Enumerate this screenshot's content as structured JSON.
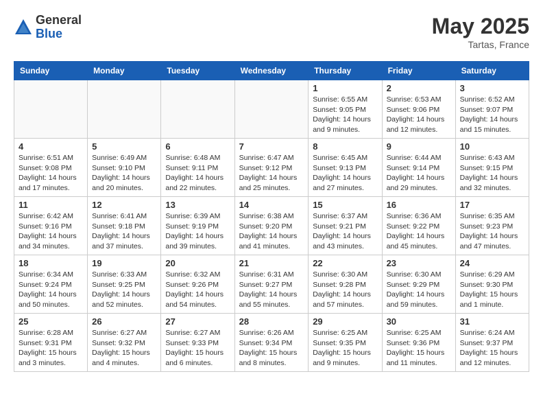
{
  "logo": {
    "general": "General",
    "blue": "Blue"
  },
  "title": "May 2025",
  "location": "Tartas, France",
  "days_header": [
    "Sunday",
    "Monday",
    "Tuesday",
    "Wednesday",
    "Thursday",
    "Friday",
    "Saturday"
  ],
  "weeks": [
    [
      {
        "day": "",
        "info": ""
      },
      {
        "day": "",
        "info": ""
      },
      {
        "day": "",
        "info": ""
      },
      {
        "day": "",
        "info": ""
      },
      {
        "day": "1",
        "info": "Sunrise: 6:55 AM\nSunset: 9:05 PM\nDaylight: 14 hours\nand 9 minutes."
      },
      {
        "day": "2",
        "info": "Sunrise: 6:53 AM\nSunset: 9:06 PM\nDaylight: 14 hours\nand 12 minutes."
      },
      {
        "day": "3",
        "info": "Sunrise: 6:52 AM\nSunset: 9:07 PM\nDaylight: 14 hours\nand 15 minutes."
      }
    ],
    [
      {
        "day": "4",
        "info": "Sunrise: 6:51 AM\nSunset: 9:08 PM\nDaylight: 14 hours\nand 17 minutes."
      },
      {
        "day": "5",
        "info": "Sunrise: 6:49 AM\nSunset: 9:10 PM\nDaylight: 14 hours\nand 20 minutes."
      },
      {
        "day": "6",
        "info": "Sunrise: 6:48 AM\nSunset: 9:11 PM\nDaylight: 14 hours\nand 22 minutes."
      },
      {
        "day": "7",
        "info": "Sunrise: 6:47 AM\nSunset: 9:12 PM\nDaylight: 14 hours\nand 25 minutes."
      },
      {
        "day": "8",
        "info": "Sunrise: 6:45 AM\nSunset: 9:13 PM\nDaylight: 14 hours\nand 27 minutes."
      },
      {
        "day": "9",
        "info": "Sunrise: 6:44 AM\nSunset: 9:14 PM\nDaylight: 14 hours\nand 29 minutes."
      },
      {
        "day": "10",
        "info": "Sunrise: 6:43 AM\nSunset: 9:15 PM\nDaylight: 14 hours\nand 32 minutes."
      }
    ],
    [
      {
        "day": "11",
        "info": "Sunrise: 6:42 AM\nSunset: 9:16 PM\nDaylight: 14 hours\nand 34 minutes."
      },
      {
        "day": "12",
        "info": "Sunrise: 6:41 AM\nSunset: 9:18 PM\nDaylight: 14 hours\nand 37 minutes."
      },
      {
        "day": "13",
        "info": "Sunrise: 6:39 AM\nSunset: 9:19 PM\nDaylight: 14 hours\nand 39 minutes."
      },
      {
        "day": "14",
        "info": "Sunrise: 6:38 AM\nSunset: 9:20 PM\nDaylight: 14 hours\nand 41 minutes."
      },
      {
        "day": "15",
        "info": "Sunrise: 6:37 AM\nSunset: 9:21 PM\nDaylight: 14 hours\nand 43 minutes."
      },
      {
        "day": "16",
        "info": "Sunrise: 6:36 AM\nSunset: 9:22 PM\nDaylight: 14 hours\nand 45 minutes."
      },
      {
        "day": "17",
        "info": "Sunrise: 6:35 AM\nSunset: 9:23 PM\nDaylight: 14 hours\nand 47 minutes."
      }
    ],
    [
      {
        "day": "18",
        "info": "Sunrise: 6:34 AM\nSunset: 9:24 PM\nDaylight: 14 hours\nand 50 minutes."
      },
      {
        "day": "19",
        "info": "Sunrise: 6:33 AM\nSunset: 9:25 PM\nDaylight: 14 hours\nand 52 minutes."
      },
      {
        "day": "20",
        "info": "Sunrise: 6:32 AM\nSunset: 9:26 PM\nDaylight: 14 hours\nand 54 minutes."
      },
      {
        "day": "21",
        "info": "Sunrise: 6:31 AM\nSunset: 9:27 PM\nDaylight: 14 hours\nand 55 minutes."
      },
      {
        "day": "22",
        "info": "Sunrise: 6:30 AM\nSunset: 9:28 PM\nDaylight: 14 hours\nand 57 minutes."
      },
      {
        "day": "23",
        "info": "Sunrise: 6:30 AM\nSunset: 9:29 PM\nDaylight: 14 hours\nand 59 minutes."
      },
      {
        "day": "24",
        "info": "Sunrise: 6:29 AM\nSunset: 9:30 PM\nDaylight: 15 hours\nand 1 minute."
      }
    ],
    [
      {
        "day": "25",
        "info": "Sunrise: 6:28 AM\nSunset: 9:31 PM\nDaylight: 15 hours\nand 3 minutes."
      },
      {
        "day": "26",
        "info": "Sunrise: 6:27 AM\nSunset: 9:32 PM\nDaylight: 15 hours\nand 4 minutes."
      },
      {
        "day": "27",
        "info": "Sunrise: 6:27 AM\nSunset: 9:33 PM\nDaylight: 15 hours\nand 6 minutes."
      },
      {
        "day": "28",
        "info": "Sunrise: 6:26 AM\nSunset: 9:34 PM\nDaylight: 15 hours\nand 8 minutes."
      },
      {
        "day": "29",
        "info": "Sunrise: 6:25 AM\nSunset: 9:35 PM\nDaylight: 15 hours\nand 9 minutes."
      },
      {
        "day": "30",
        "info": "Sunrise: 6:25 AM\nSunset: 9:36 PM\nDaylight: 15 hours\nand 11 minutes."
      },
      {
        "day": "31",
        "info": "Sunrise: 6:24 AM\nSunset: 9:37 PM\nDaylight: 15 hours\nand 12 minutes."
      }
    ]
  ]
}
